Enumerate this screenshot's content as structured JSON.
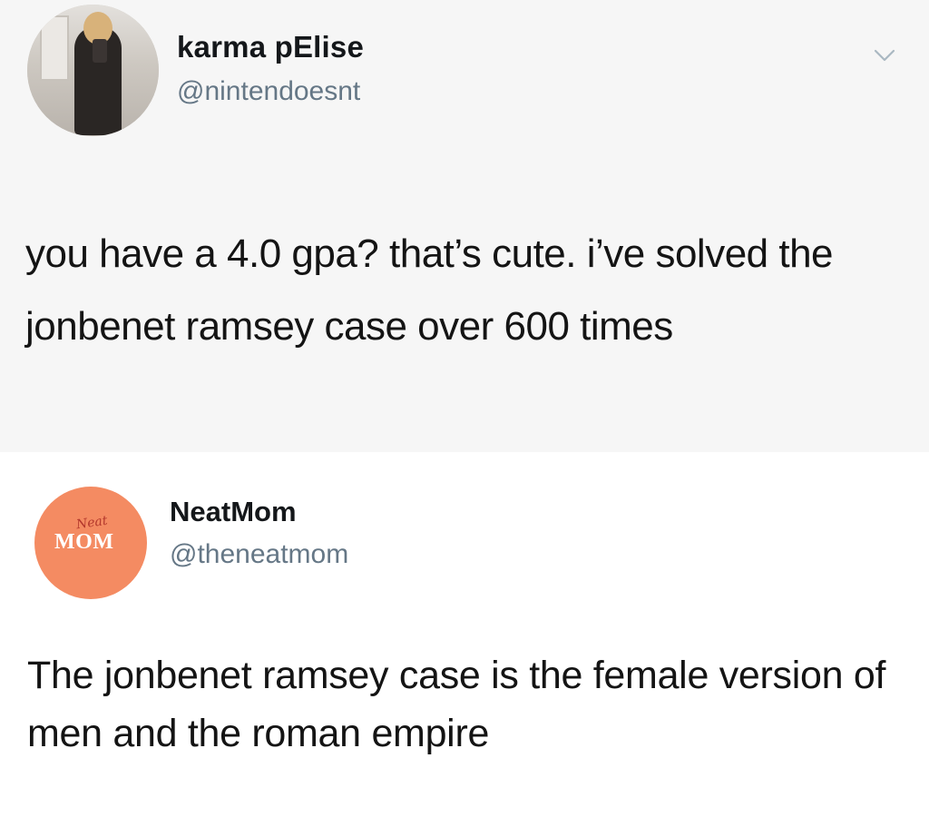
{
  "tweets": [
    {
      "display_name": "karma pElise",
      "handle": "@nintendoesnt",
      "text": "you have a 4.0 gpa? that’s cute. i’ve solved the jonbenet ramsey case over 600 times",
      "avatar_icon": "profile-photo",
      "menu_icon": "chevron-down-icon"
    },
    {
      "display_name": "NeatMom",
      "handle": "@theneatmom",
      "text": "The jonbenet ramsey case is the female version of men and the roman empire",
      "avatar_icon": "neat-mom-logo",
      "avatar_logo_text": {
        "script": "Neat",
        "main": "MOM"
      },
      "avatar_color": "#f48b62"
    }
  ],
  "colors": {
    "name": "#14171a",
    "handle": "#657786",
    "body_text": "#141414",
    "top_background": "#f6f6f6"
  }
}
